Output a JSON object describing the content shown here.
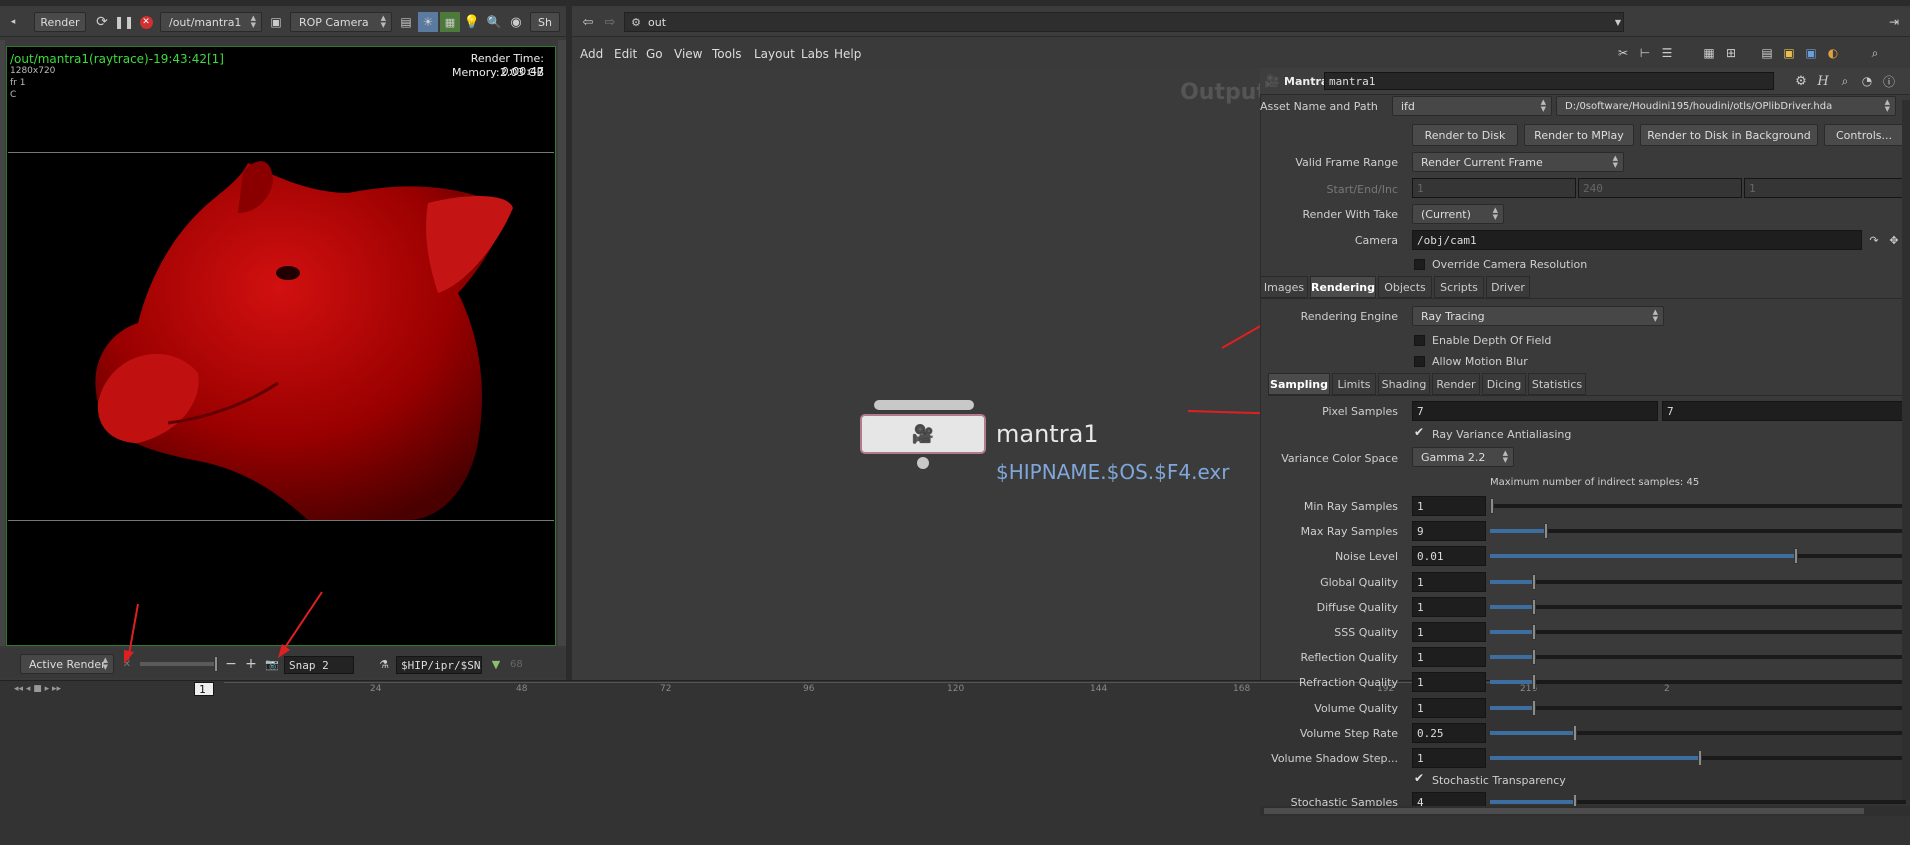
{
  "left_toolbar": {
    "render_label": "Render",
    "rop_path": "/out/mantra1",
    "camera_select": "ROP Camera",
    "sh_label": "Sh"
  },
  "viewport": {
    "title": "/out/mantra1(raytrace)-19:43:42[1]",
    "resolution": "1280x720",
    "frame": "fr 1",
    "channel": "C",
    "render_time": "Render Time: 0:00:47",
    "memory_label": "Memory:",
    "memory_value": "2.03 GB"
  },
  "left_bottom": {
    "active_render": "Active Render",
    "snap": "Snap 2",
    "snap_path": "$HIP/ipr/$SNAPI",
    "value_68": "68"
  },
  "timeline": {
    "frame": "1",
    "ticks": [
      "24",
      "48",
      "72",
      "96",
      "120",
      "144",
      "168",
      "192",
      "216",
      "2"
    ]
  },
  "network": {
    "path": "out",
    "menu": [
      "Add",
      "Edit",
      "Go",
      "View",
      "Tools",
      "Layout",
      "Labs",
      "Help"
    ],
    "watermark": "Outputs",
    "node_name": "mantra1",
    "node_output": "$HIPNAME.$OS.$F4.exr"
  },
  "params": {
    "node_type": "Mantra",
    "node_name": "mantra1",
    "asset_label": "Asset Name and Path",
    "asset_type": "ifd",
    "asset_path": "D:/0software/Houdini195/houdini/otls/OPlibDriver.hda",
    "buttons": [
      "Render to Disk",
      "Render to MPlay",
      "Render to Disk in Background",
      "Controls..."
    ],
    "valid_frame_range_label": "Valid Frame Range",
    "valid_frame_range": "Render Current Frame",
    "start_end_inc_label": "Start/End/Inc",
    "start": "1",
    "end": "240",
    "inc": "1",
    "render_with_take_label": "Render With Take",
    "render_with_take": "(Current)",
    "camera_label": "Camera",
    "camera": "/obj/cam1",
    "override_cam_res": "Override Camera Resolution",
    "tabs": [
      "Images",
      "Rendering",
      "Objects",
      "Scripts",
      "Driver"
    ],
    "rendering_engine_label": "Rendering Engine",
    "rendering_engine": "Ray Tracing",
    "enable_dof": "Enable Depth Of Field",
    "allow_motion_blur": "Allow Motion Blur",
    "subtabs": [
      "Sampling",
      "Limits",
      "Shading",
      "Render",
      "Dicing",
      "Statistics"
    ],
    "pixel_samples_label": "Pixel Samples",
    "pixel_samples_x": "7",
    "pixel_samples_y": "7",
    "ray_variance_aa": "Ray Variance Antialiasing",
    "variance_color_space_label": "Variance Color Space",
    "variance_color_space": "Gamma 2.2",
    "indirect_note": "Maximum number of indirect samples: 45",
    "rows": [
      {
        "label": "Min Ray Samples",
        "value": "1",
        "level": 0.0
      },
      {
        "label": "Max Ray Samples",
        "value": "9",
        "level": 0.13
      },
      {
        "label": "Noise Level",
        "value": "0.01",
        "level": 0.73
      },
      {
        "label": "Global Quality",
        "value": "1",
        "level": 0.1
      },
      {
        "label": "Diffuse Quality",
        "value": "1",
        "level": 0.1
      },
      {
        "label": "SSS Quality",
        "value": "1",
        "level": 0.1
      },
      {
        "label": "Reflection Quality",
        "value": "1",
        "level": 0.1
      },
      {
        "label": "Refraction Quality",
        "value": "1",
        "level": 0.1
      },
      {
        "label": "Volume Quality",
        "value": "1",
        "level": 0.1
      },
      {
        "label": "Volume Step Rate",
        "value": "0.25",
        "level": 0.2
      },
      {
        "label": "Volume Shadow Step...",
        "value": "1",
        "level": 0.5
      }
    ],
    "stochastic_transparency": "Stochastic Transparency",
    "stochastic_samples_label": "Stochastic Samples",
    "stochastic_samples": "4",
    "stochastic_samples_level": 0.2
  },
  "colors": {
    "annotation_arrow": "#e02020",
    "viewport_text": "#3ddc3d",
    "node_output": "#7fa7d9",
    "pig": "#b00000"
  }
}
